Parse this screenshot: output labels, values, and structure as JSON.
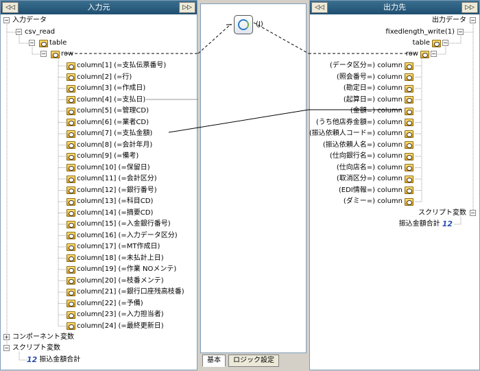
{
  "left": {
    "title": "入力元",
    "nav_prev": "◁◁",
    "nav_next": "▷▷",
    "root": "入力データ",
    "csv": "csv_read",
    "table": "table",
    "row": "row",
    "columns": [
      "column[1] (=支払伝票番号)",
      "column[2] (=行)",
      "column[3] (=作成日)",
      "column[4] (=支払日)",
      "column[5] (=管理CD)",
      "column[6] (=業者CD)",
      "column[7] (=支払金額)",
      "column[8] (=会計年月)",
      "column[9] (=備考)",
      "column[10] (=保留日)",
      "column[11] (=会計区分)",
      "column[12] (=銀行番号)",
      "column[13] (=科目CD)",
      "column[14] (=摘要CD)",
      "column[15] (=入金銀行番号)",
      "column[16] (=入力データ区分)",
      "column[17] (=MT作成日)",
      "column[18] (=未払計上日)",
      "column[19] (=作業 NOメンテ)",
      "column[20] (=枝番メンテ)",
      "column[21] (=銀行口座残高枝番)",
      "column[22] (=予備)",
      "column[23] (=入力担当者)",
      "column[24] (=最終更新日)"
    ],
    "component_vars": "コンポーネント変数",
    "script_vars": "スクリプト変数",
    "script_var_item": "振込金額合計"
  },
  "mid": {
    "func_label": "(J)",
    "tabs": [
      "基本",
      "ロジック設定"
    ]
  },
  "right": {
    "title": "出力先",
    "nav_prev": "◁◁",
    "nav_next": "▷▷",
    "root": "出力データ",
    "writer": "fixedlength_write(1)",
    "table": "table",
    "row": "row",
    "columns": [
      "(データ区分=) column",
      "(照会番号=) column",
      "(勘定日=) column",
      "(起算日=) column",
      "(金額=) column",
      "(うち他店券金額=) column",
      "(振込依頼人コード=) column",
      "(振込依頼人名=) column",
      "(仕向銀行名=) column",
      "(仕向店名=) column",
      "(取消区分=) column",
      "(EDI情報=) column",
      "(ダミー=) column"
    ],
    "script_vars": "スクリプト変数",
    "script_var_item": "振込金額合計"
  },
  "icons": {
    "column": "column-icon",
    "table": "table-icon",
    "number": "number-icon",
    "function": "function-icon"
  }
}
